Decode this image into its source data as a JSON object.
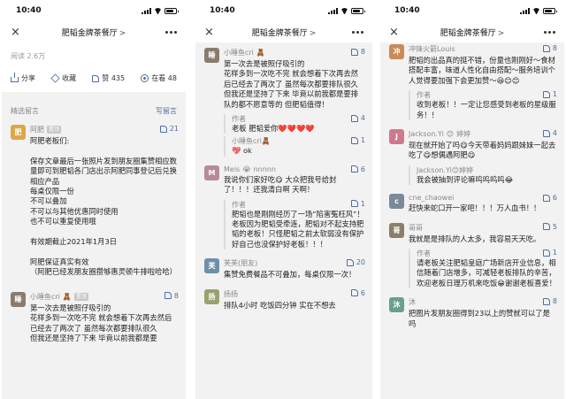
{
  "status": {
    "time": "10:40"
  },
  "title": "肥韬金牌茶餐厅",
  "title_chevron": ">",
  "close_icon": "×",
  "colors": {
    "link": "#576b95",
    "badge": "#c7c7c7",
    "bg": "#f2f2f2"
  },
  "p1": {
    "reads": "阅读 2.6万",
    "actions": {
      "share": "分享",
      "fav": "收藏",
      "like": "赞 435",
      "look": "在看 48"
    },
    "section_label": "精选留言",
    "write": "写留言",
    "comments": [
      {
        "name": "阿肥",
        "badge": "置顶",
        "likes": "21",
        "body": "阿肥老板们:\n\n保存文章最后一张照片发到朋友圈集赞相应数量即可到肥韬各门店出示阿肥同事登记后兑换相应产品\n每桌仅限一份\n不可以叠加\n不可以与其他优惠同时使用\n也不可以重复使用哦\n\n有效期截止2021年1月3日\n\n阿肥保证真实有效\n（阿肥已经发朋友圈攒够惠灵顿牛排啦哈哈）"
      },
      {
        "name": "小睡鱼cri",
        "emoji": "🧸",
        "badge": "置顶",
        "likes": "8",
        "body": "第一次去是被照仔吸引的\n花样多到一次吃不完 就会想着下次再去然后已经去了两次了 虽然每次都要排队很久\n但我还是坚持了下来 毕竟以前我都是要"
      }
    ]
  },
  "p2": {
    "comments": [
      {
        "name": "小睡鱼cri",
        "emoji": "🧸",
        "likes": "8",
        "body": "第一次去是被照仔吸引的\n花样多到一次吃不完 就会想着下次再去然后已经去了两次了 虽然每次都要排队很久\n但我还是坚持了下来 毕竟以前我都是要排队的都不愿意等的 但肥韬值得！",
        "reply": {
          "name": "作者",
          "body": "老板 肥韬爱你❤️❤️❤️❤️",
          "likes": "4"
        },
        "reply2": {
          "name": "小睡鱼cri",
          "emoji": "🧸",
          "body": "💖 ok",
          "likes": "1"
        }
      },
      {
        "name": "Meis",
        "emoji": "😭",
        "name_suffix": "nnnnn",
        "likes": "6",
        "body": "我说你们家好吃😋 大众把我号给封了！！！还我清白啊 天啊！",
        "reply": {
          "name": "作者",
          "body": "肥韬也是刚刚经历了一场“陷害冤枉风”！老板因为肥韬受牵连，肥韬对不起支持肥韬的老板！只怪肥韬之前太软弱没有保护好自己也没保护好老板！！！",
          "likes": "1"
        }
      },
      {
        "name": "芙芙(朋友)",
        "likes": "20",
        "body": "集赞免费餐品不可叠加，每桌仅限一次！"
      },
      {
        "name": "扬扬",
        "likes": "6",
        "body": "排队4小时 吃饭四分钟 实在不想去"
      }
    ]
  },
  "p3": {
    "comments": [
      {
        "name": "冲锋火箭Louis",
        "likes": "8",
        "body": "肥韬的出品真的挺不错，份量也刚刚好～食材搭配丰富，味道人性化自由搭配～服务培训个人觉得要加强下会更加赞～😆😊😊",
        "reply": {
          "name": "作者",
          "body": "收到老板！！一定让您感受到老板的星级服务！！",
          "likes": "1"
        }
      },
      {
        "name": "Jackson.Yi",
        "emoji": "😊",
        "name_suffix": "婷婷",
        "likes": "4",
        "body": "现在就开始了吗😋今天带着妈妈跟妹妹一起去吃了😋想偶遇阿肥😋",
        "reply": {
          "name": "Jackson.Yi😊婷婷",
          "body": "我会被抽到评论嘛呜呜呜呜😂",
          "likes": ""
        }
      },
      {
        "name": "cne_chaowei",
        "likes": "6",
        "body": "赶快来蛇口开一家吧！！！万人血书！！"
      },
      {
        "name": "哥哥",
        "likes": "5",
        "body": "我就是是排队的人太多，我容易天天吃。",
        "reply": {
          "name": "作者",
          "body": "请老板关注肥韬皇庭广场新店开业信息，相信随着门店增多，可减轻老板排队的辛苦，欢迎老板日理万机来吃饭😁谢谢老板喜爱！",
          "likes": "1"
        }
      },
      {
        "name": "沐",
        "likes": "8",
        "body": "把图片发朋友圈得到23以上的赞就可以了是吗"
      }
    ]
  }
}
